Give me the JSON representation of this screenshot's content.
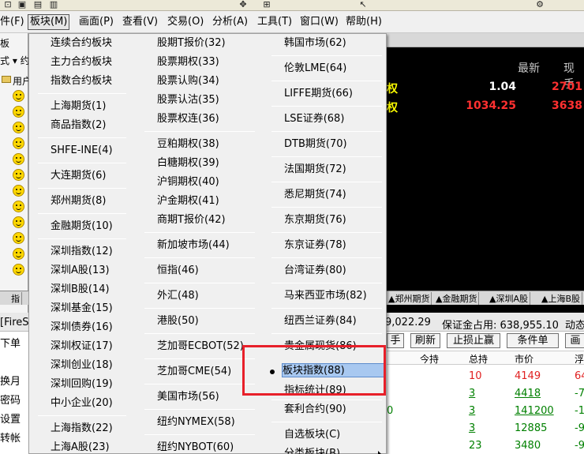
{
  "menubar": {
    "items": [
      "件(F)",
      "板块(M)",
      "画面(P)",
      "查看(V)",
      "交易(O)",
      "分析(A)",
      "工具(T)",
      "窗口(W)",
      "帮助(H)"
    ],
    "active_index": 1
  },
  "left_panel": {
    "label_1": "板",
    "label_2": "式 ▾ 约",
    "label_3": "用户"
  },
  "quotes": {
    "headers": [
      "最新",
      "现手"
    ],
    "rows": [
      {
        "name": "权",
        "last": "1.04",
        "last_color": "#ffffff",
        "cur": "2701"
      },
      {
        "name": "权",
        "last": "1034.25",
        "last_color": "#ff3030",
        "cur": "3638"
      }
    ]
  },
  "tabs": {
    "left": "指",
    "items": [
      "▲郑州期货",
      "▲金融期货",
      "▲深圳A股",
      "▲上海B股"
    ]
  },
  "status": {
    "left_label": "[FireS",
    "equity": "9,022.29",
    "margin": "保证金占用: 638,955.10",
    "right": "动态"
  },
  "order_buttons": [
    "手",
    "刷新",
    "止损止赢",
    "条件单",
    "画"
  ],
  "order_columns": [
    "今持",
    "总持",
    "市价",
    "浮"
  ],
  "order_rows": [
    {
      "total": "10",
      "total_color": "#e02020",
      "price": "4149",
      "price_color": "#e02020",
      "float": "64",
      "float_color": "#e02020",
      "prefix": ""
    },
    {
      "total": "3",
      "total_color": "#008000",
      "price": "4418",
      "price_color": "#008000",
      "float": "-7",
      "float_color": "#008000",
      "prefix": ""
    },
    {
      "total": "3",
      "total_color": "#008000",
      "price": "141200",
      "price_color": "#008000",
      "float": "-1",
      "float_color": "#008000",
      "prefix": "0"
    },
    {
      "total": "3",
      "total_color": "#008000",
      "price": "12885",
      "price_color": "#008000",
      "float": "-9",
      "float_color": "#008000",
      "prefix": ""
    },
    {
      "total": "23",
      "total_color": "#008000",
      "price": "3480",
      "price_color": "#008000",
      "float": "-9",
      "float_color": "#008000",
      "prefix": ""
    }
  ],
  "order_left_labels": [
    "下单",
    "换月",
    "密码",
    "设置",
    "转帐"
  ],
  "menu": {
    "col1": [
      "连续合约板块",
      "主力合约板块",
      "指数合约板块",
      "上海期货(1)",
      "商品指数(2)",
      "SHFE-INE(4)",
      "大连期货(6)",
      "郑州期货(8)",
      "金融期货(10)",
      "深圳指数(12)",
      "深圳A股(13)",
      "深圳B股(14)",
      "深圳基金(15)",
      "深圳债券(16)",
      "深圳权证(17)",
      "深圳创业(18)",
      "深圳回购(19)",
      "中小企业(20)",
      "上海指数(22)",
      "上海A股(23)"
    ],
    "col2": [
      "股期T报价(32)",
      "股票期权(33)",
      "股票认购(34)",
      "股票认沽(35)",
      "股票权连(36)",
      "豆粕期权(38)",
      "白糖期权(39)",
      "沪铜期权(40)",
      "沪金期权(41)",
      "商期T报价(42)",
      "新加坡市场(44)",
      "恒指(46)",
      "外汇(48)",
      "港股(50)",
      "芝加哥ECBOT(52)",
      "芝加哥CME(54)",
      "美国市场(56)",
      "纽约NYMEX(58)",
      "纽约NYBOT(60)"
    ],
    "col3": [
      "韩国市场(62)",
      "伦敦LME(64)",
      "LIFFE期货(66)",
      "LSE证券(68)",
      "DTB期货(70)",
      "法国期货(72)",
      "悉尼期货(74)",
      "东京期货(76)",
      "东京证券(78)",
      "台湾证券(80)",
      "马来西亚市场(82)",
      "纽西兰证券(84)",
      "贵金属现货(86)",
      "板块指数(88)",
      "指标统计(89)",
      "套利合约(90)",
      "自选板块(C)",
      "分类板块(B)"
    ],
    "highlighted": "板块指数(88)"
  }
}
